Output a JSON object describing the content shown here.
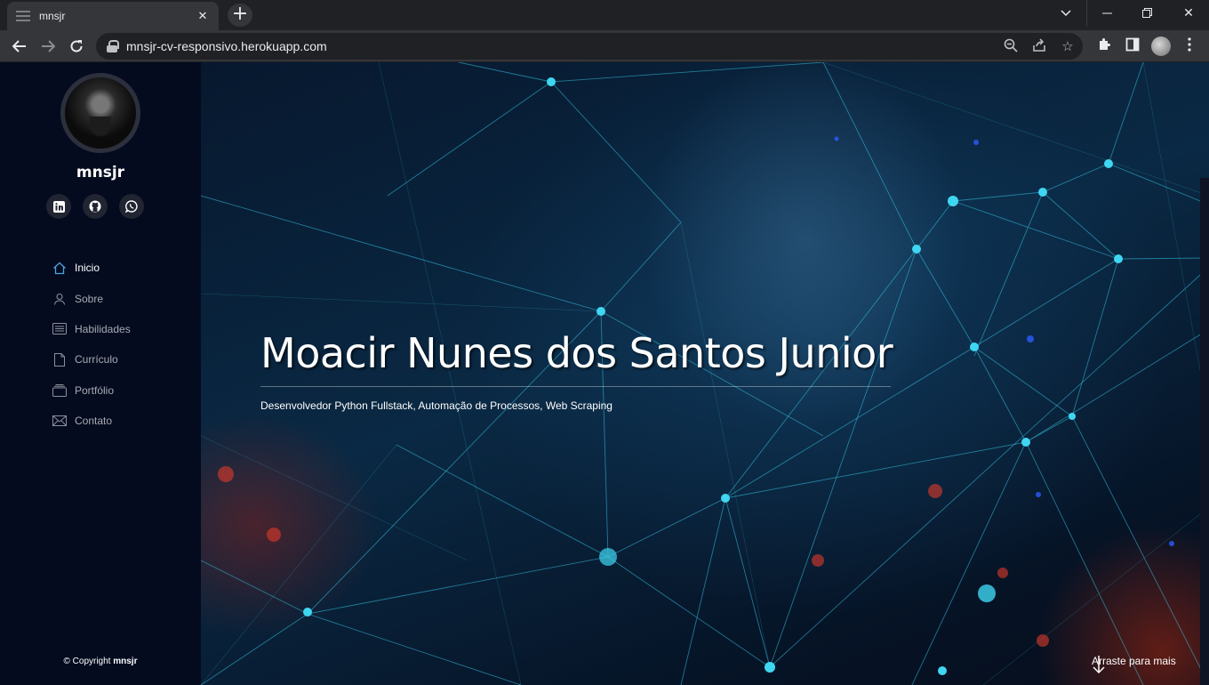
{
  "browser": {
    "tab_title": "mnsjr",
    "url": "mnsjr-cv-responsivo.herokuapp.com"
  },
  "sidebar": {
    "name": "mnsjr",
    "socials": [
      {
        "icon": "linkedin-icon",
        "glyph": "in"
      },
      {
        "icon": "github-icon",
        "glyph": "gh"
      },
      {
        "icon": "whatsapp-icon",
        "glyph": "wa"
      }
    ],
    "nav": [
      {
        "label": "Inicio",
        "icon": "home-icon",
        "active": true
      },
      {
        "label": "Sobre",
        "icon": "user-icon",
        "active": false
      },
      {
        "label": "Habilidades",
        "icon": "skills-icon",
        "active": false
      },
      {
        "label": "Currículo",
        "icon": "document-icon",
        "active": false
      },
      {
        "label": "Portfólio",
        "icon": "portfolio-icon",
        "active": false
      },
      {
        "label": "Contato",
        "icon": "envelope-icon",
        "active": false
      }
    ],
    "copyright_prefix": "© Copyright",
    "copyright_name": "mnsjr"
  },
  "hero": {
    "title": "Moacir Nunes dos Santos Junior",
    "subtitle": "Desenvolvedor Python Fullstack, Automação de Processos, Web Scraping",
    "scroll_hint": "Arraste para mais"
  },
  "colors": {
    "sidebar_bg": "#040b1f",
    "accent": "#2fc9e6",
    "active_icon": "#4aa3df"
  }
}
